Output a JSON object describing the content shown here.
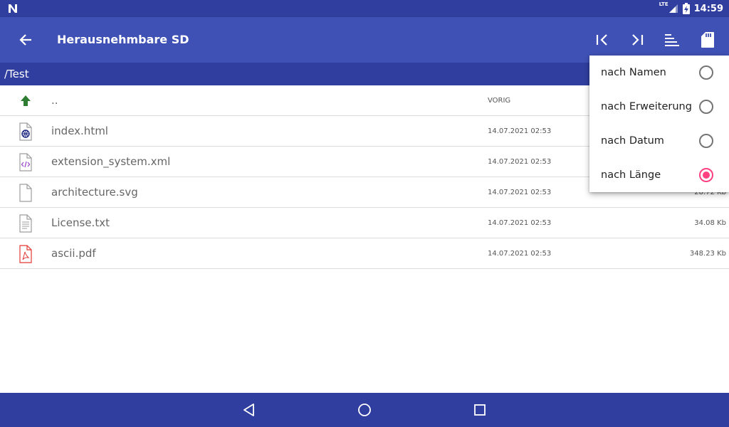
{
  "status_bar": {
    "network": "LTE",
    "time": "14:59",
    "icons": [
      "n-logo-icon",
      "signal-icon",
      "battery-charging-icon"
    ]
  },
  "app_bar": {
    "title": "Herausnehmbare SD",
    "icons": [
      "arrow-back-icon",
      "skip-first-icon",
      "skip-last-icon",
      "sort-icon",
      "sd-card-icon"
    ]
  },
  "path": "/Test",
  "files": [
    {
      "name": "..",
      "date": "VORIG",
      "size": "",
      "icon": "arrow-up-icon"
    },
    {
      "name": "index.html",
      "date": "14.07.2021 02:53",
      "size": "",
      "icon": "html-file-icon"
    },
    {
      "name": "extension_system.xml",
      "date": "14.07.2021 02:53",
      "size": "",
      "icon": "xml-file-icon"
    },
    {
      "name": "architecture.svg",
      "date": "14.07.2021 02:53",
      "size": "28.72 Kb",
      "icon": "file-icon"
    },
    {
      "name": "License.txt",
      "date": "14.07.2021 02:53",
      "size": "34.08 Kb",
      "icon": "text-file-icon"
    },
    {
      "name": "ascii.pdf",
      "date": "14.07.2021 02:53",
      "size": "348.23 Kb",
      "icon": "pdf-file-icon"
    }
  ],
  "sort_menu": {
    "items": [
      {
        "label": "nach Namen",
        "checked": false
      },
      {
        "label": "nach Erweiterung",
        "checked": false
      },
      {
        "label": "nach Datum",
        "checked": false
      },
      {
        "label": "nach Länge",
        "checked": true
      }
    ]
  },
  "colors": {
    "primary": "#3f51b5",
    "primary_dark": "#303f9f",
    "accent": "#ff4081",
    "up_arrow": "#2e7d32",
    "pdf": "#e53935",
    "xml": "#9c4dcc",
    "html": "#1a237e"
  },
  "nav_bar": {
    "icons": [
      "nav-back-icon",
      "nav-home-icon",
      "nav-recents-icon"
    ]
  }
}
